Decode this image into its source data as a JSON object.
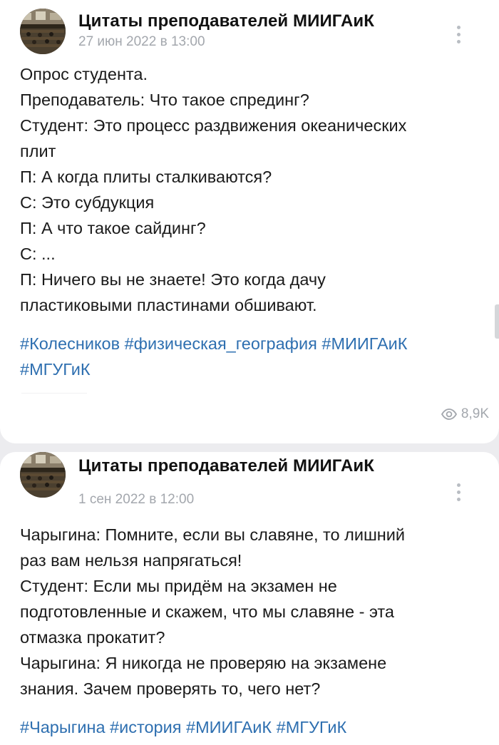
{
  "posts": [
    {
      "author": "Цитаты преподавателей МИИГАиК",
      "date": "27 июн 2022 в 13:00",
      "avatar_icon": "community-avatar-classroom",
      "menu_icon": "more-vertical-icon",
      "lines": [
        "Опрос студента.",
        "Преподаватель: Что такое спрединг?",
        "Студент: Это процесс раздвижения океанических",
        "плит",
        "П: А когда плиты сталкиваются?",
        "С: Это субдукция",
        "П: А что такое сайдинг?",
        "С: ...",
        "П: Ничего вы не знаете! Это когда дачу",
        "пластиковыми пластинами обшивают."
      ],
      "tags": [
        "#Колесников",
        "#физическая_география",
        "#МИИГАиК",
        "#МГУГиК"
      ],
      "views": "8,9K",
      "views_icon": "eye-icon"
    },
    {
      "author": "Цитаты преподавателей МИИГАиК",
      "date": "1 сен 2022 в 12:00",
      "avatar_icon": "community-avatar-classroom",
      "menu_icon": "more-vertical-icon",
      "lines": [
        "Чарыгина: Помните, если вы славяне, то лишний",
        "раз вам нельзя напрягаться!",
        "Студент: Если мы придём на экзамен не",
        "подготовленные и скажем, что мы славяне - эта",
        "отмазка прокатит?",
        "Чарыгина: Я никогда не проверяю на экзамене",
        "знания. Зачем проверять то, чего нет?"
      ],
      "tags": [
        "#Чарыгина",
        "#история",
        "#МИИГАиК",
        "#МГУГиК"
      ]
    }
  ],
  "colors": {
    "background": "#ececef",
    "card": "#ffffff",
    "text": "#1a1a1a",
    "hashtag": "#2e6fb0",
    "muted": "#a3a7ad"
  }
}
